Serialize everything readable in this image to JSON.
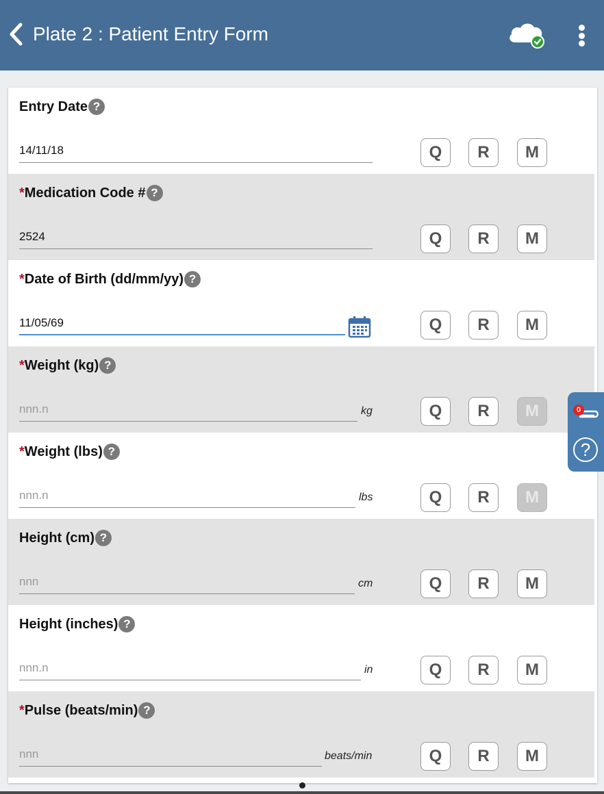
{
  "header": {
    "title": "Plate 2 : Patient Entry Form",
    "back_icon": "chevron-left-icon",
    "sync_icon": "cloud-check-icon",
    "menu_icon": "more-vertical-icon"
  },
  "help_glyph": "?",
  "required_marker": "*",
  "buttons": {
    "q": "Q",
    "r": "R",
    "m": "M"
  },
  "fields": [
    {
      "label": "Entry Date",
      "required": false,
      "value": "14/11/18",
      "placeholder": "",
      "unit": "",
      "m_disabled": false
    },
    {
      "label": "Medication Code #",
      "required": true,
      "value": "2524",
      "placeholder": "",
      "unit": "",
      "m_disabled": false
    },
    {
      "label": "Date of Birth (dd/mm/yy)",
      "required": true,
      "value": "11/05/69",
      "placeholder": "",
      "unit": "",
      "m_disabled": false,
      "active": true,
      "icon": "calendar-icon"
    },
    {
      "label": "Weight (kg)",
      "required": true,
      "value": "",
      "placeholder": "nnn.n",
      "unit": "kg",
      "m_disabled": true
    },
    {
      "label": "Weight (lbs)",
      "required": true,
      "value": "",
      "placeholder": "nnn.n",
      "unit": "lbs",
      "m_disabled": true
    },
    {
      "label": "Height (cm)",
      "required": false,
      "value": "",
      "placeholder": "nnn",
      "unit": "cm",
      "m_disabled": false
    },
    {
      "label": "Height (inches)",
      "required": false,
      "value": "",
      "placeholder": "nnn.n",
      "unit": "in",
      "m_disabled": false
    },
    {
      "label": "Pulse (beats/min)",
      "required": true,
      "value": "",
      "placeholder": "nnn",
      "unit": "beats/min",
      "m_disabled": false
    }
  ],
  "side_panel": {
    "attachments_count": "0",
    "attachments_icon": "paperclip-icon",
    "help_icon": "help-circle-icon",
    "help_glyph": "?"
  },
  "colors": {
    "header": "#466e96",
    "side_panel": "#4a7db0",
    "required": "#b0122a",
    "badge": "#e02424",
    "active_underline": "#4a8fd0"
  }
}
